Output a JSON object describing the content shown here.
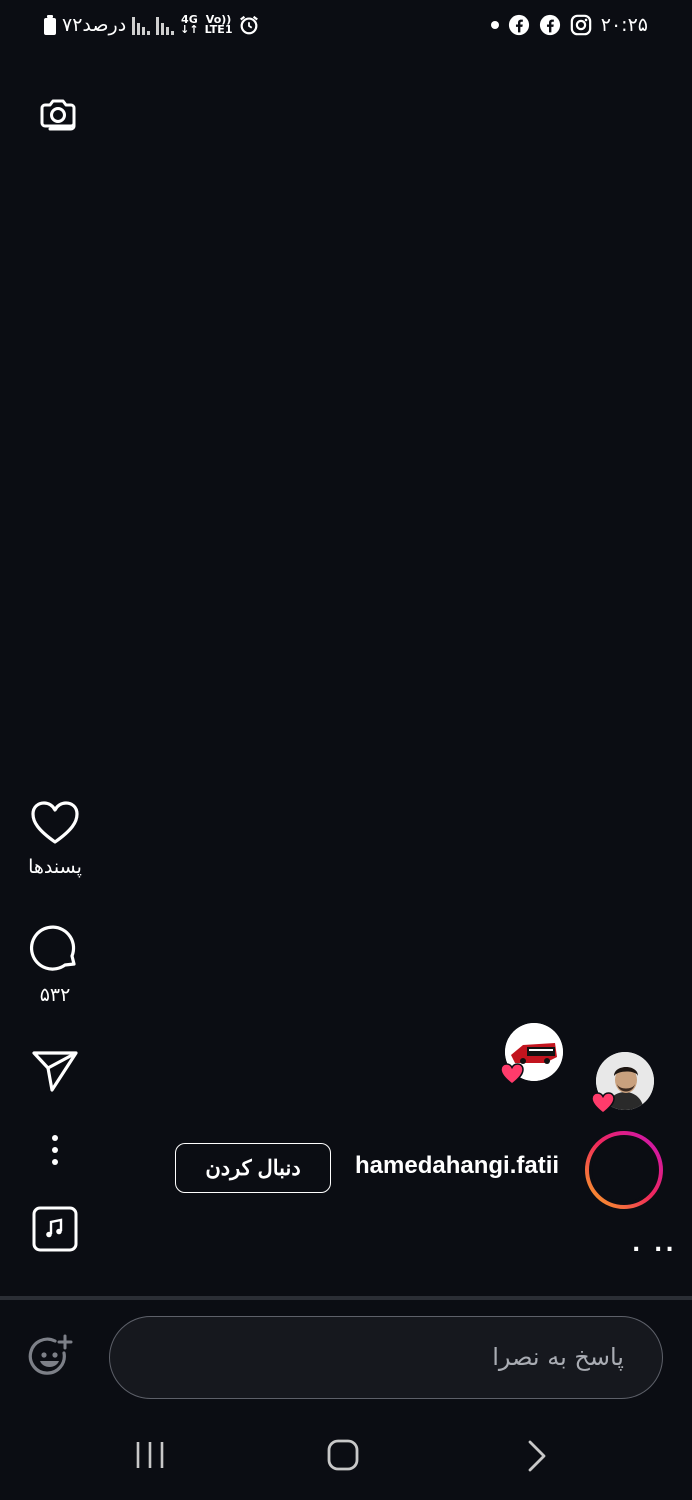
{
  "status_bar": {
    "battery_text": "۷۲درصد",
    "network_top": "4G",
    "network_volte": "Vo))",
    "network_lte": "LTE1",
    "time": "۲۰:۲۵"
  },
  "actions": {
    "likes_label": "پسندها",
    "comments_count": "۵۳۲"
  },
  "profile": {
    "username": "hamedahangi.fatii",
    "follow_label": "دنبال کردن",
    "caption_more": ". .."
  },
  "reply": {
    "placeholder": "پاسخ به نصرا"
  },
  "colors": {
    "background": "#0b0d13",
    "ring_start": "#c913b9",
    "ring_end": "#f9a825",
    "heart": "#ff3b6b"
  }
}
